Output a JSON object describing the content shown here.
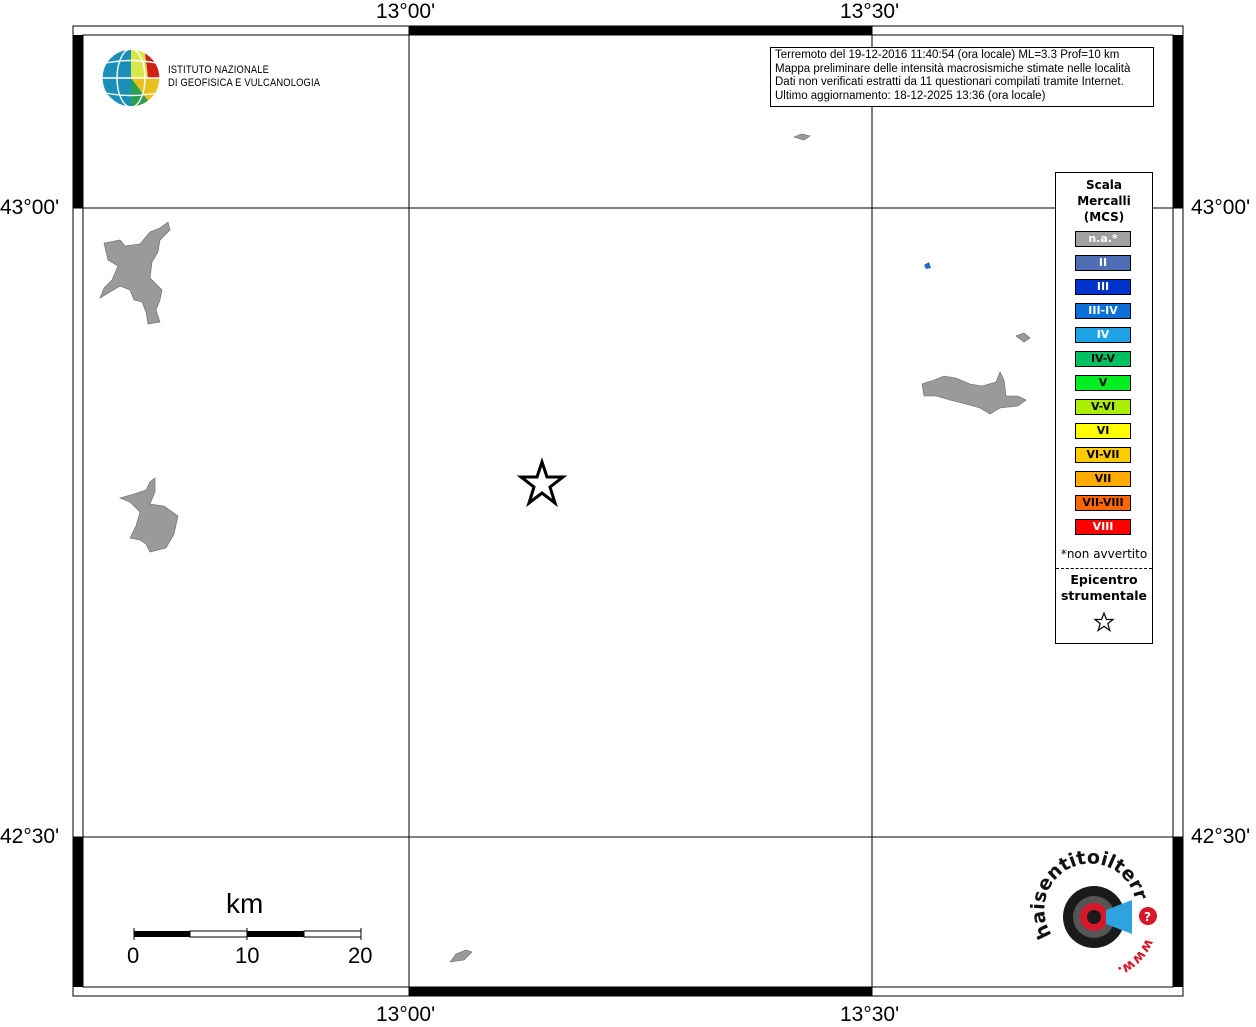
{
  "map": {
    "lon_labels": [
      "13°00'",
      "13°30'"
    ],
    "lat_labels": [
      "43°00'",
      "42°30'"
    ]
  },
  "info": {
    "lines": [
      "Terremoto del 19-12-2016 11:40:54 (ora locale) ML=3.3 Prof=10 km",
      "Mappa preliminare delle intensità macrosismiche stimate nelle località",
      "Dati non verificati estratti da 11 questionari compilati tramite Internet.",
      "Ultimo aggiornamento: 18-12-2025 13:36 (ora locale)"
    ]
  },
  "logo": {
    "line1": "ISTITUTO NAZIONALE",
    "line2": "DI GEOFISICA E VULCANOLOGIA",
    "icon": "ingv-globe-logo"
  },
  "legend": {
    "title_lines": [
      "Scala",
      "Mercalli",
      "(MCS)"
    ],
    "items": [
      {
        "label": "n.a.*",
        "color": "#a0a0a0",
        "text_color": "#ffffff"
      },
      {
        "label": "II",
        "color": "#4f6db5",
        "text_color": "#ffffff"
      },
      {
        "label": "III",
        "color": "#0033cc",
        "text_color": "#ffffff"
      },
      {
        "label": "III-IV",
        "color": "#0a6fd6",
        "text_color": "#ffffff"
      },
      {
        "label": "IV",
        "color": "#1ea2e6",
        "text_color": "#ffffff"
      },
      {
        "label": "IV-V",
        "color": "#00c060",
        "text_color": "#000000"
      },
      {
        "label": "V",
        "color": "#00ee22",
        "text_color": "#000000"
      },
      {
        "label": "V-VI",
        "color": "#aaee00",
        "text_color": "#000000"
      },
      {
        "label": "VI",
        "color": "#ffff00",
        "text_color": "#000000"
      },
      {
        "label": "VI-VII",
        "color": "#ffcc00",
        "text_color": "#000000"
      },
      {
        "label": "VII",
        "color": "#ffaa00",
        "text_color": "#000000"
      },
      {
        "label": "VII-VIII",
        "color": "#ff6600",
        "text_color": "#000000"
      },
      {
        "label": "VIII",
        "color": "#ff0000",
        "text_color": "#ffffff"
      }
    ],
    "note": "*non avvertito",
    "epicenter_lines": [
      "Epicentro",
      "strumentale"
    ],
    "epicenter_icon": "star-icon"
  },
  "scalebar": {
    "title": "km",
    "ticks": [
      "0",
      "10",
      "20"
    ]
  },
  "hst_logo": {
    "text": "haisentitoilterremoto.it",
    "prefix": "www."
  },
  "colors": {
    "lake": "#9a9a9a",
    "locality_dot": "#1a6fc4"
  }
}
